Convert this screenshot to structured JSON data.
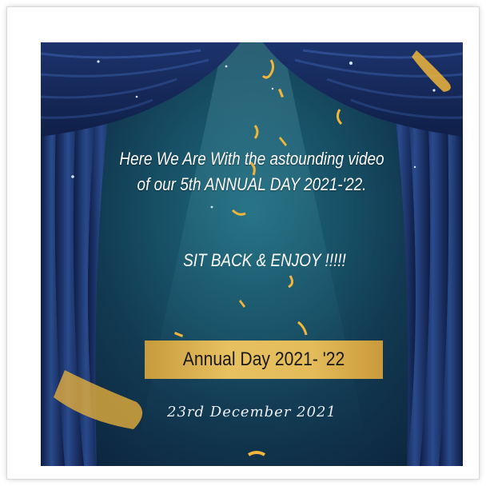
{
  "poster": {
    "headline_line1": "Here We Are With the astounding video",
    "headline_line2": "of our 5th ANNUAL DAY 2021-'22.",
    "tagline": "SIT BACK & ENJOY !!!!!",
    "banner_title": "Annual Day 2021- '22",
    "date": "23rd December 2021"
  },
  "colors": {
    "background": "#123a52",
    "curtain": "#1a2f5e",
    "banner_gold": "#e4bc5a",
    "confetti": "#f0b53a"
  },
  "icons": [
    "curtain-left-icon",
    "curtain-right-icon",
    "curtain-valance-icon",
    "confetti-icon",
    "sparkle-icon"
  ]
}
